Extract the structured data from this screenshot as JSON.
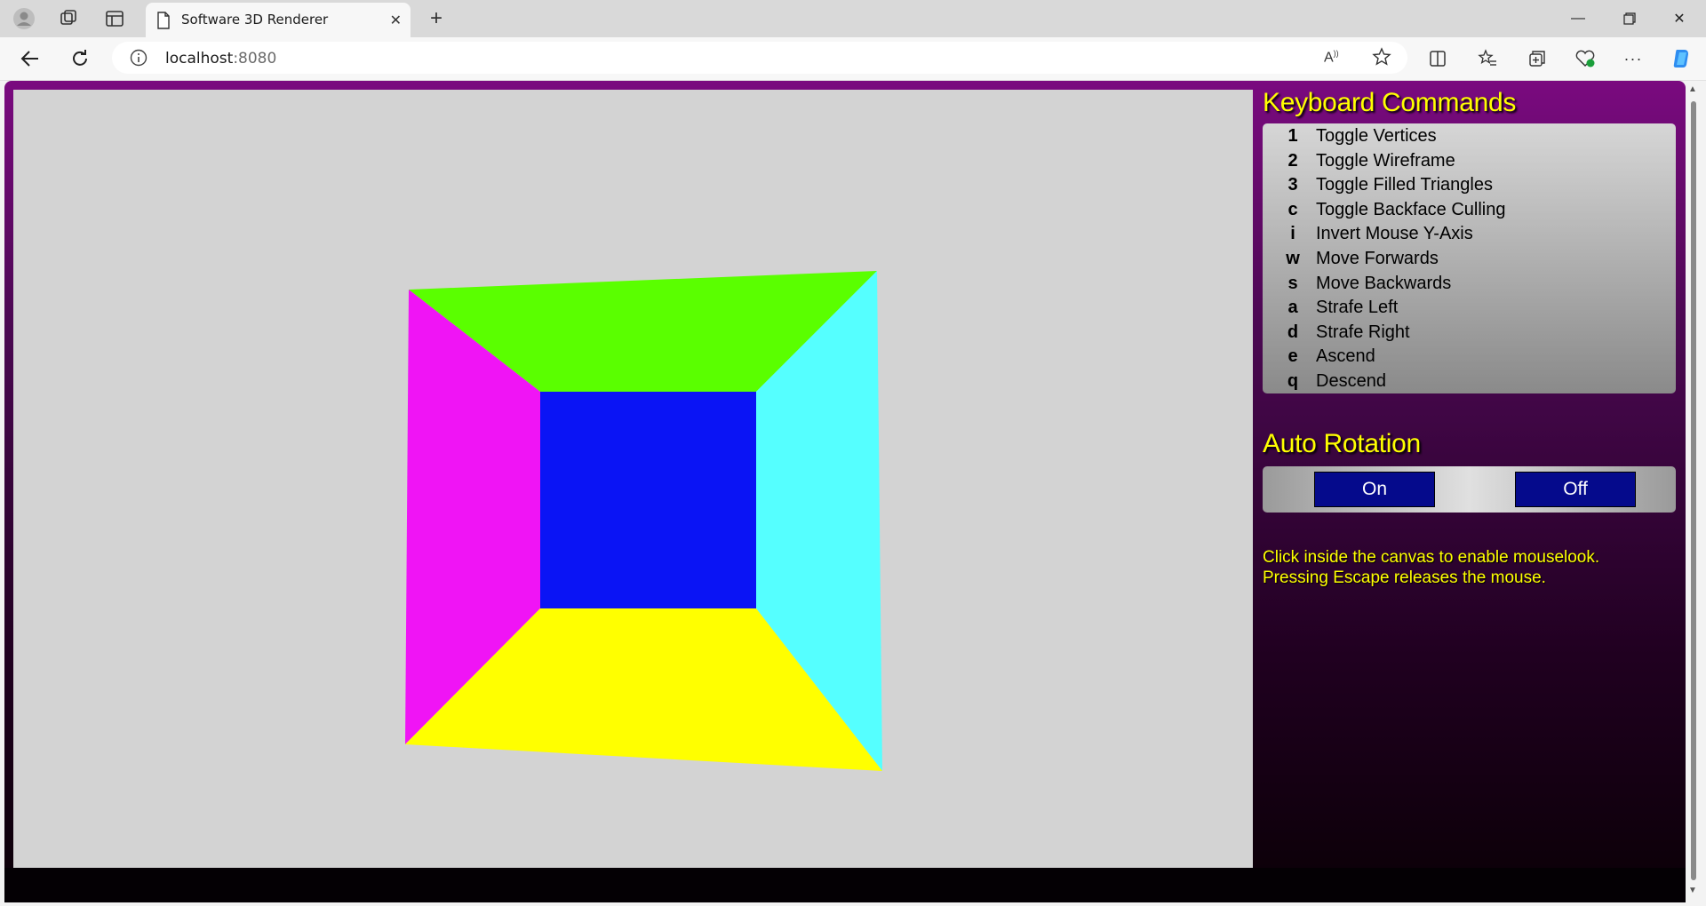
{
  "browser": {
    "tab_title": "Software 3D Renderer",
    "url_host": "localhost",
    "url_port": ":8080"
  },
  "panel": {
    "keyboard_title": "Keyboard Commands",
    "commands": [
      {
        "key": "1",
        "label": "Toggle Vertices"
      },
      {
        "key": "2",
        "label": "Toggle Wireframe"
      },
      {
        "key": "3",
        "label": "Toggle Filled Triangles"
      },
      {
        "key": "c",
        "label": "Toggle Backface Culling"
      },
      {
        "key": "i",
        "label": "Invert Mouse Y-Axis"
      },
      {
        "key": "w",
        "label": "Move Forwards"
      },
      {
        "key": "s",
        "label": "Move Backwards"
      },
      {
        "key": "a",
        "label": "Strafe Left"
      },
      {
        "key": "d",
        "label": "Strafe Right"
      },
      {
        "key": "e",
        "label": "Ascend"
      },
      {
        "key": "q",
        "label": "Descend"
      }
    ],
    "rotation_title": "Auto Rotation",
    "rotation_on": "On",
    "rotation_off": "Off",
    "info_line1": "Click inside the canvas to enable mouselook.",
    "info_line2": "Pressing Escape releases the mouse."
  },
  "colors": {
    "top_face": "#5aff00",
    "left_face": "#f014f5",
    "right_face": "#55ffff",
    "bottom_face": "#ffff00",
    "back_face": "#0a14f5",
    "accent": "#ffff00",
    "button_bg": "#050a8c"
  }
}
